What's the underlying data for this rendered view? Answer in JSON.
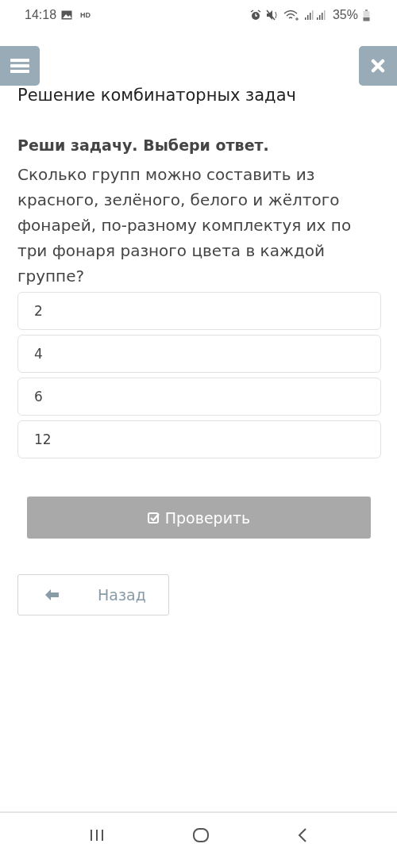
{
  "status_bar": {
    "time": "14:18",
    "hd_label": "HD",
    "battery": "35%"
  },
  "header": {
    "title": "Решение комбинаторных задач"
  },
  "task": {
    "instruction": "Реши задачу. Выбери ответ.",
    "question": "Сколько групп можно составить из красного, зелёного, белого и жёлтого фонарей, по-разному комплектуя их по три фонаря разного цвета в каждой группе?"
  },
  "options": [
    {
      "label": "2",
      "selected": false
    },
    {
      "label": "4",
      "selected": false
    },
    {
      "label": "6",
      "selected": false
    },
    {
      "label": "12",
      "selected": false
    }
  ],
  "check_button": {
    "label": "Проверить",
    "disabled": true
  },
  "back_button": {
    "label": "Назад"
  }
}
